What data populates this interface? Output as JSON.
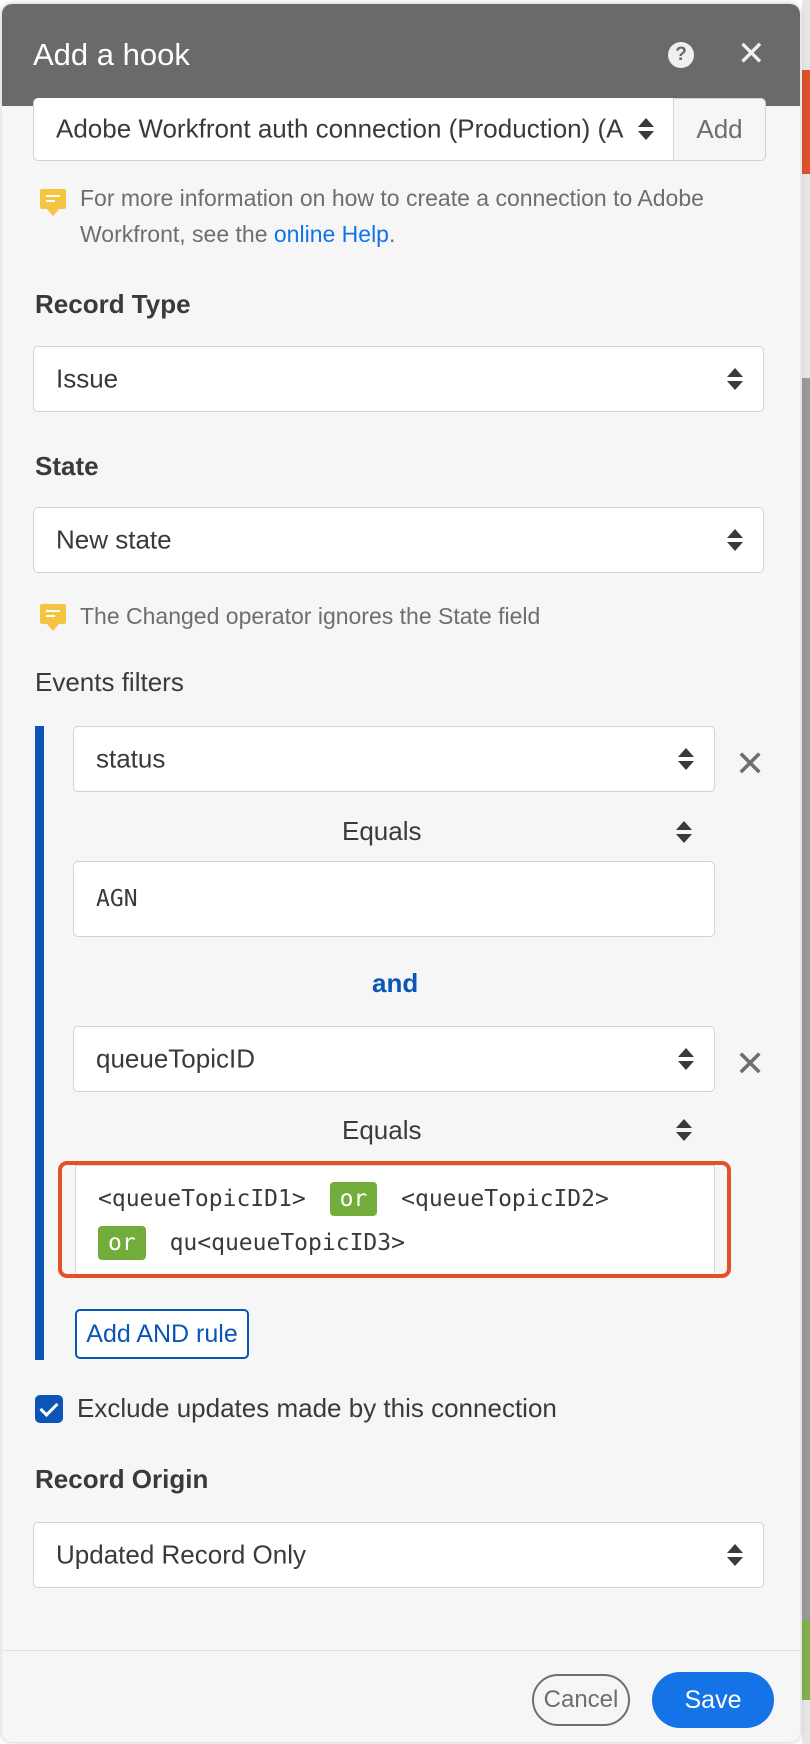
{
  "header": {
    "title": "Add a hook",
    "help_icon": "?",
    "close_icon": "✕"
  },
  "connection": {
    "value": "Adobe Workfront auth connection (Production) (A",
    "add_label": "Add"
  },
  "connection_note": {
    "text_before": "For more information on how to create a connection to Adobe Workfront, see the ",
    "link": "online Help",
    "text_after": "."
  },
  "record_type": {
    "label": "Record Type",
    "value": "Issue"
  },
  "state": {
    "label": "State",
    "value": "New state",
    "note": "The Changed operator ignores the State field"
  },
  "events_filters": {
    "label": "Events filters",
    "rule1": {
      "field": "status",
      "operator": "Equals",
      "value": "AGN"
    },
    "conjunction": "and",
    "rule2": {
      "field": "queueTopicID",
      "operator": "Equals",
      "values": [
        "<queueTopicID1>",
        "or",
        "<queueTopicID2>",
        "or",
        "qu<queueTopicID3>"
      ]
    },
    "add_and_label": "Add AND rule",
    "remove_icon": "✕"
  },
  "exclude_updates": {
    "label": "Exclude updates made by this connection",
    "checked": true
  },
  "record_origin": {
    "label": "Record Origin",
    "value": "Updated Record Only"
  },
  "footer": {
    "cancel_label": "Cancel",
    "save_label": "Save"
  },
  "colors": {
    "header": "#6a6a6a",
    "accent_blue": "#0a55b5",
    "link_blue": "#1473e6",
    "chip_green": "#72ad3c",
    "highlight_red": "#e2512a",
    "note_yellow": "#f5c542"
  }
}
